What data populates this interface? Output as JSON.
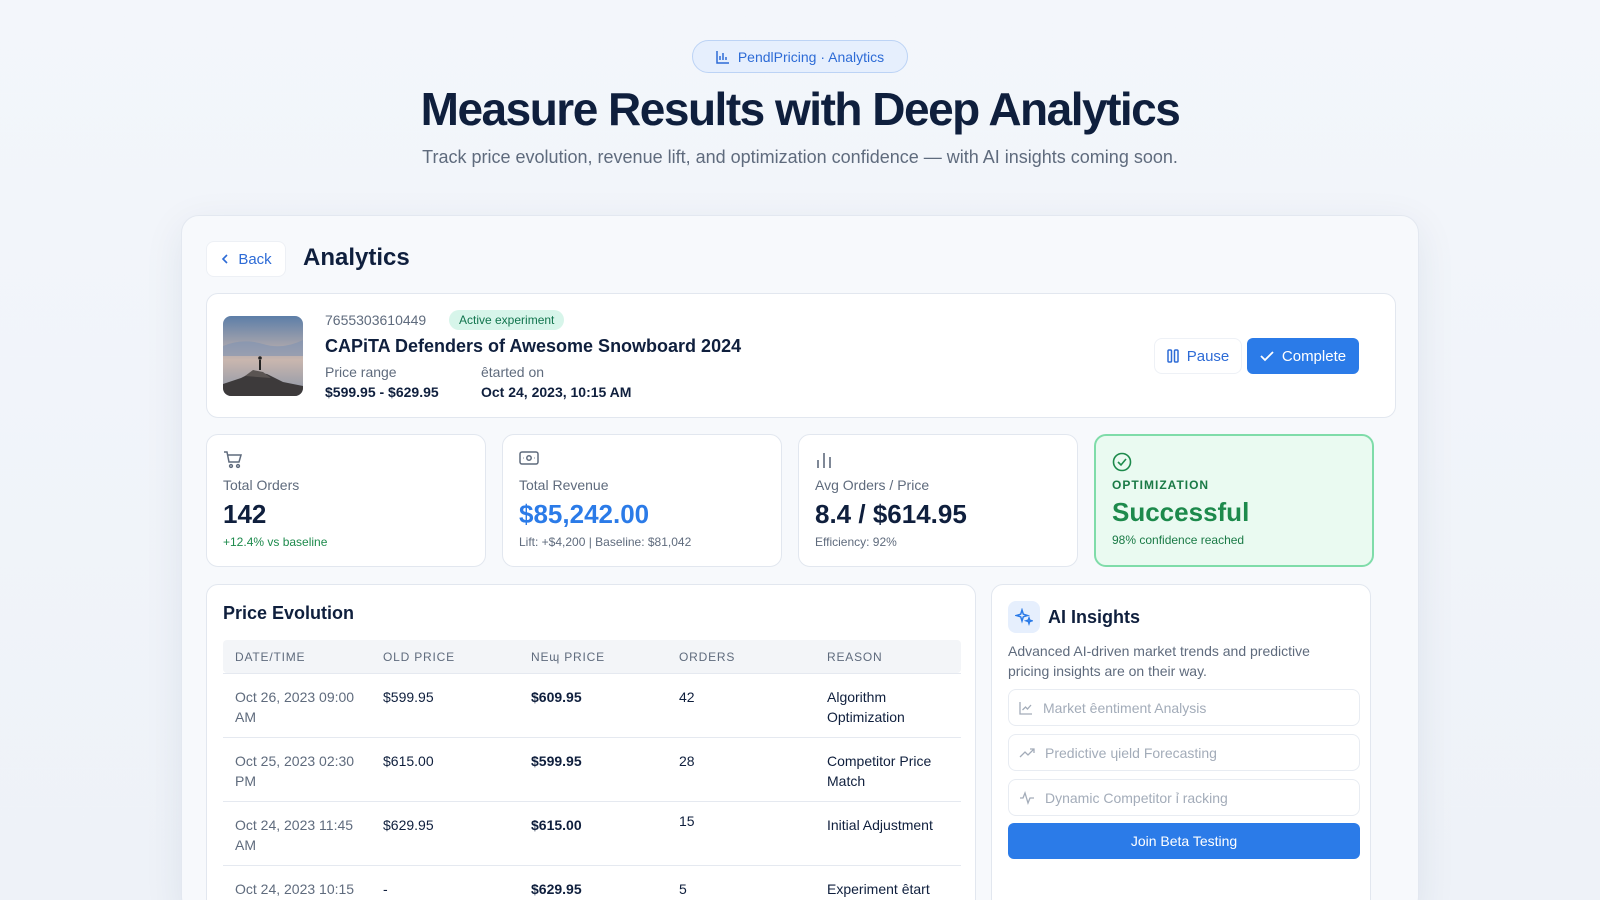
{
  "header": {
    "pill_label": "PendlPricing · Analytics",
    "title": "Measure Results with Deep Analytics",
    "subtitle": "Track price evolution, revenue lift, and optimization confidence — with AI insights coming soon."
  },
  "panel": {
    "back_label": "Back",
    "title": "Analytics"
  },
  "product": {
    "id": "7655303610449",
    "status_badge": "Active experiment",
    "name": "CAPiTA Defenders of Awesome Snowboard 2024",
    "price_range_label": "Price range",
    "price_range_value": "$599.95 - $629.95",
    "started_label": "ȇtarted on",
    "started_value": "Oct 24, 2023, 10:15 AM",
    "pause_label": "Pause",
    "complete_label": "Complete"
  },
  "stats": {
    "orders": {
      "label": "Total Orders",
      "value": "142",
      "sub": "+12.4% vs baseline"
    },
    "revenue": {
      "label": "Total Revenue",
      "value": "$85,242.00",
      "sub": "Lift: +$4,200 | Baseline: $81,042"
    },
    "avg": {
      "label": "Avg Orders / Price",
      "value": "8.4 / $614.95",
      "sub": "Efficiency: 92%"
    },
    "optimization": {
      "label": "OPTIMIZATION",
      "value": "Successful",
      "sub": "98% confidence reached"
    }
  },
  "evolution": {
    "title": "Price Evolution",
    "columns": [
      "DATE/TIME",
      "OLD PRICE",
      "NEɰ PRICE",
      "ORDERS",
      "REASON"
    ],
    "rows": [
      {
        "date": "Oct 26, 2023 09:00 AM",
        "old": "$599.95",
        "new": "$609.95",
        "orders": "42",
        "reason": "Algorithm Optimization"
      },
      {
        "date": "Oct 25, 2023 02:30 PM",
        "old": "$615.00",
        "new": "$599.95",
        "orders": "28",
        "reason": "Competitor Price Match"
      },
      {
        "date": "Oct 24, 2023 11:45 AM",
        "old": "$629.95",
        "new": "$615.00",
        "orders": "15",
        "reason": "Initial Adjustment"
      },
      {
        "date": "Oct 24, 2023 10:15",
        "old": "-",
        "new": "$629.95",
        "orders": "5",
        "reason": "Experiment ȇtart"
      }
    ]
  },
  "ai": {
    "title": "AI Insights",
    "description": "Advanced AI-driven market trends and predictive pricing insights are on their way.",
    "features": [
      "Market ȇentiment Analysis",
      "Predictive ɥield Forecasting",
      "Dynamic Competitor ỉ racking"
    ],
    "beta_label": "Join Beta Testing"
  },
  "colors": {
    "accent": "#2b7be8",
    "success": "#1d8a4c",
    "text": "#0f1f3d"
  }
}
